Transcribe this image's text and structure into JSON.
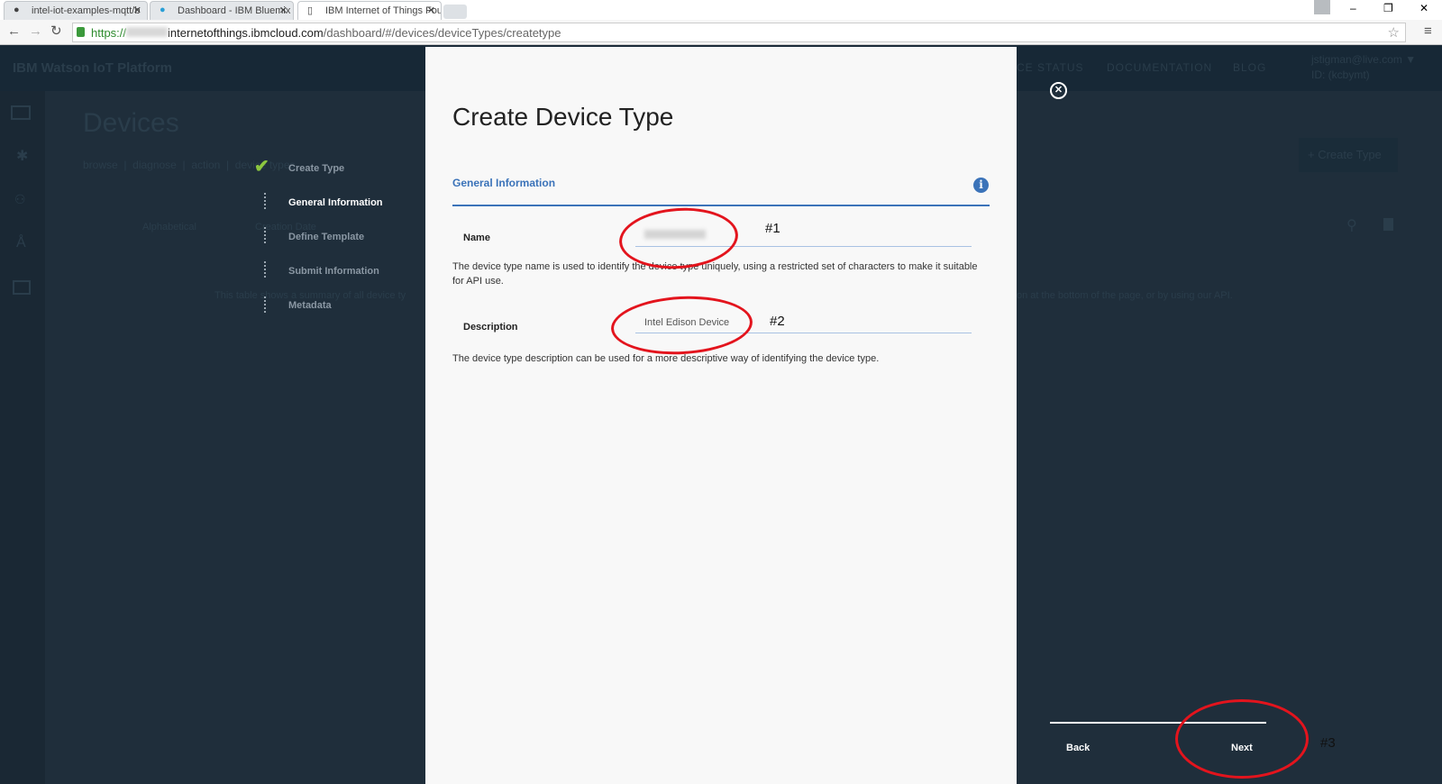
{
  "browser": {
    "tabs": [
      {
        "label": "intel-iot-examples-mqtt/b",
        "icon": "github-icon"
      },
      {
        "label": "Dashboard - IBM Bluemix",
        "icon": "bluemix-icon"
      },
      {
        "label": "IBM Internet of Things Fou",
        "icon": "page-icon"
      }
    ],
    "url_scheme": "https://",
    "url_host": "internetofthings.ibmcloud.com",
    "url_path": "/dashboard/#/devices/deviceTypes/createtype"
  },
  "background": {
    "app_title": "IBM Watson IoT Platform",
    "nav": [
      "CE STATUS",
      "DOCUMENTATION",
      "BLOG"
    ],
    "user": "jstigman@live.com ▼",
    "org": "ID: (kcbymt)",
    "page_title": "Devices",
    "subnav": [
      "browse",
      "diagnose",
      "action",
      "device types"
    ],
    "create_button": "+ Create Type",
    "columns": [
      "Alphabetical",
      "Creation Date"
    ],
    "summary_left": "This table shows a summary of all device ty",
    "summary_right": "on at the bottom of the page, or by using our API."
  },
  "stepper": [
    {
      "label": "Create Type",
      "state": "done"
    },
    {
      "label": "General Information",
      "state": "active"
    },
    {
      "label": "Define Template",
      "state": "pending"
    },
    {
      "label": "Submit Information",
      "state": "pending"
    },
    {
      "label": "Metadata",
      "state": "pending"
    }
  ],
  "modal": {
    "title": "Create Device Type",
    "section": "General Information",
    "name_label": "Name",
    "name_value": "",
    "name_help": "The device type name is used to identify the device type uniquely, using a restricted set of characters to make it suitable for API use.",
    "description_label": "Description",
    "description_value": "Intel Edison Device",
    "description_help": "The device type description can be used for a more descriptive way of identifying the device type."
  },
  "footer": {
    "back": "Back",
    "next": "Next"
  },
  "annotations": [
    "#1",
    "#2",
    "#3"
  ],
  "colors": {
    "accent": "#3b73b9",
    "annotation": "#e3141d",
    "check": "#8cc63f"
  }
}
